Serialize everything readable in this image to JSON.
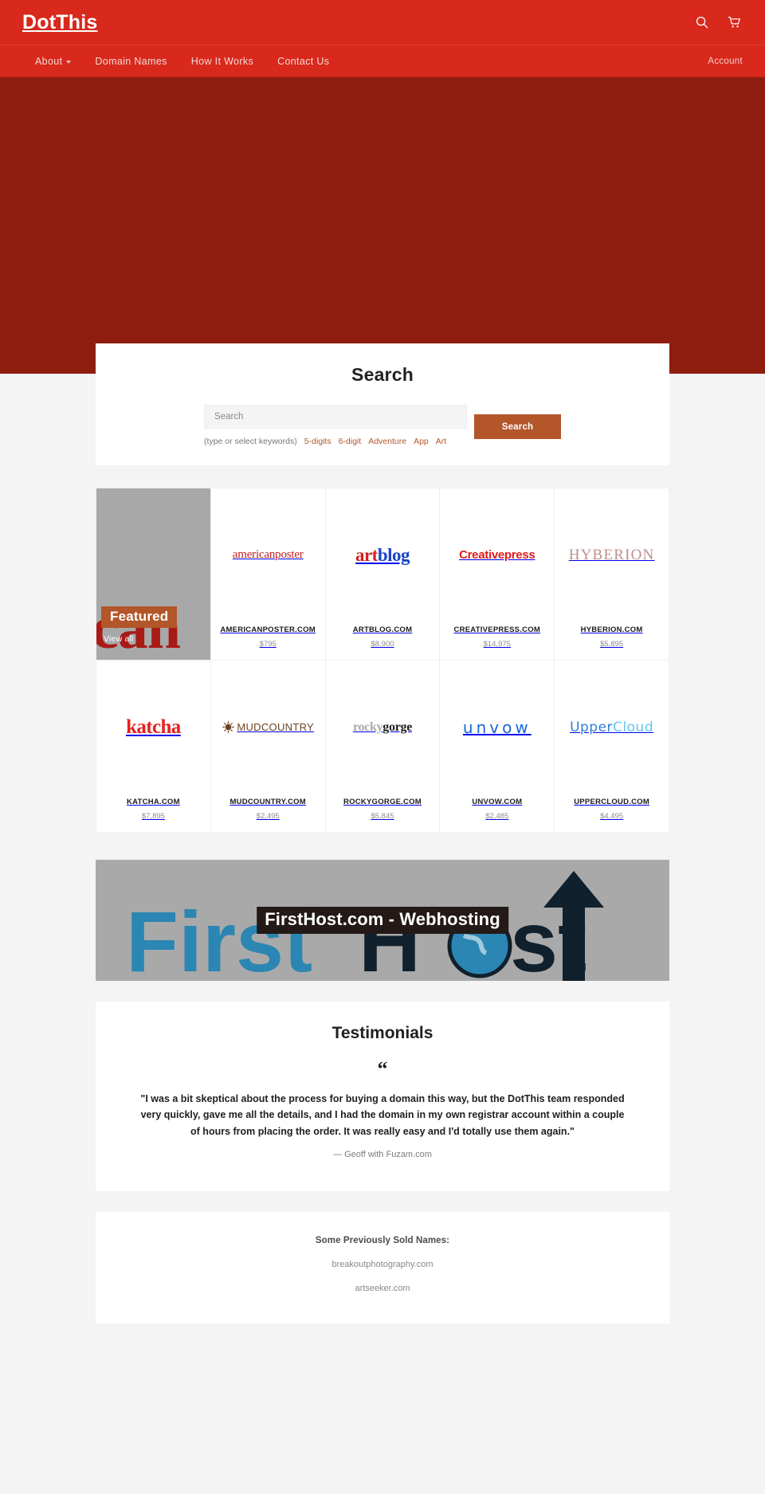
{
  "header": {
    "logo": "DotThis",
    "search_icon": "search-icon",
    "cart_icon": "cart-icon"
  },
  "nav": {
    "items": [
      {
        "label": "About",
        "has_caret": true
      },
      {
        "label": "Domain Names",
        "has_caret": false
      },
      {
        "label": "How It Works",
        "has_caret": false
      },
      {
        "label": "Contact Us",
        "has_caret": false
      }
    ],
    "account_label": "Account"
  },
  "search": {
    "title": "Search",
    "placeholder": "Search",
    "value": "",
    "submit_label": "Search",
    "hint": "(type or select keywords)",
    "keywords": [
      "5-digits",
      "6-digit",
      "Adventure",
      "App",
      "Art"
    ]
  },
  "featured": {
    "badge": "Featured",
    "view_all": "View all",
    "bg_text": "can"
  },
  "products": [
    {
      "logo_text": "americanposter",
      "name": "AMERICANPOSTER.COM",
      "price": "$795",
      "style": "lg-americanposter"
    },
    {
      "logo_text": "artblog",
      "name": "ARTBLOG.COM",
      "price": "$8,900",
      "style": "lg-artblog"
    },
    {
      "logo_text": "Creativepress",
      "name": "CREATIVEPRESS.COM",
      "price": "$14,975",
      "style": "lg-creativepress"
    },
    {
      "logo_text": "HYBERION",
      "name": "HYBERION.COM",
      "price": "$5,895",
      "style": "lg-hyberion"
    },
    {
      "logo_text": "katcha",
      "name": "KATCHA.COM",
      "price": "$7,895",
      "style": "lg-katcha"
    },
    {
      "logo_text": "MUDCOUNTRY",
      "name": "MUDCOUNTRY.COM",
      "price": "$2,495",
      "style": "lg-mudcountry"
    },
    {
      "logo_text": "rockygorge",
      "name": "ROCKYGORGE.COM",
      "price": "$5,845",
      "style": "lg-rockygorge"
    },
    {
      "logo_text": "unvow",
      "name": "UNVOW.COM",
      "price": "$2,485",
      "style": "lg-unvow"
    },
    {
      "logo_text": "UpperCloud",
      "name": "UPPERCLOUD.COM",
      "price": "$4,495",
      "style": "lg-uppercloud"
    }
  ],
  "promo": {
    "label": "FirstHost.com - Webhosting",
    "art_text": "FirstHost"
  },
  "testimonials": {
    "title": "Testimonials",
    "quote_mark": "“",
    "quote": "\"I was a bit skeptical about the process for buying a domain this way, but the DotThis team responded very quickly, gave me all the details, and I had the domain in my own registrar account within a couple of hours from placing the order. It was really easy and I'd totally use them again.\"",
    "author": "— Geoff with Fuzam.com"
  },
  "sold": {
    "title": "Some Previously Sold Names:",
    "items": [
      "breakoutphotography.com",
      "artseeker.com"
    ]
  },
  "colors": {
    "brand_red": "#d8291c",
    "hero_red": "#8e1d10",
    "accent_orange": "#b3562a",
    "page_bg": "#f4f4f4"
  }
}
